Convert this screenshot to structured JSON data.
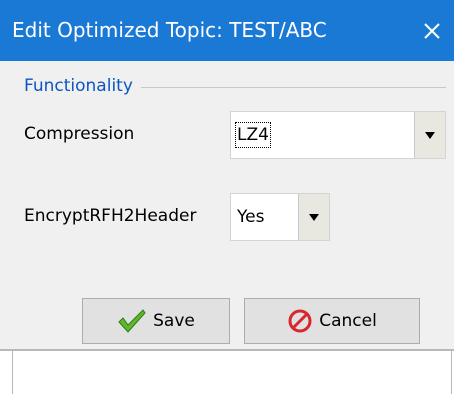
{
  "window": {
    "title": "Edit Optimized Topic: TEST/ABC"
  },
  "group": {
    "label": "Functionality"
  },
  "fields": [
    {
      "label": "Compression",
      "value": "LZ4"
    },
    {
      "label": "EncryptRFH2Header",
      "value": "Yes"
    }
  ],
  "buttons": {
    "save_label": "Save",
    "cancel_label": "Cancel"
  },
  "colors": {
    "titlebar": "#1b79d6",
    "group_label": "#0b55c4",
    "save_icon": "#5cb82a",
    "cancel_icon": "#d9262e"
  },
  "icons": {
    "close": "close-icon",
    "save": "checkmark-icon",
    "cancel": "no-entry-icon"
  }
}
